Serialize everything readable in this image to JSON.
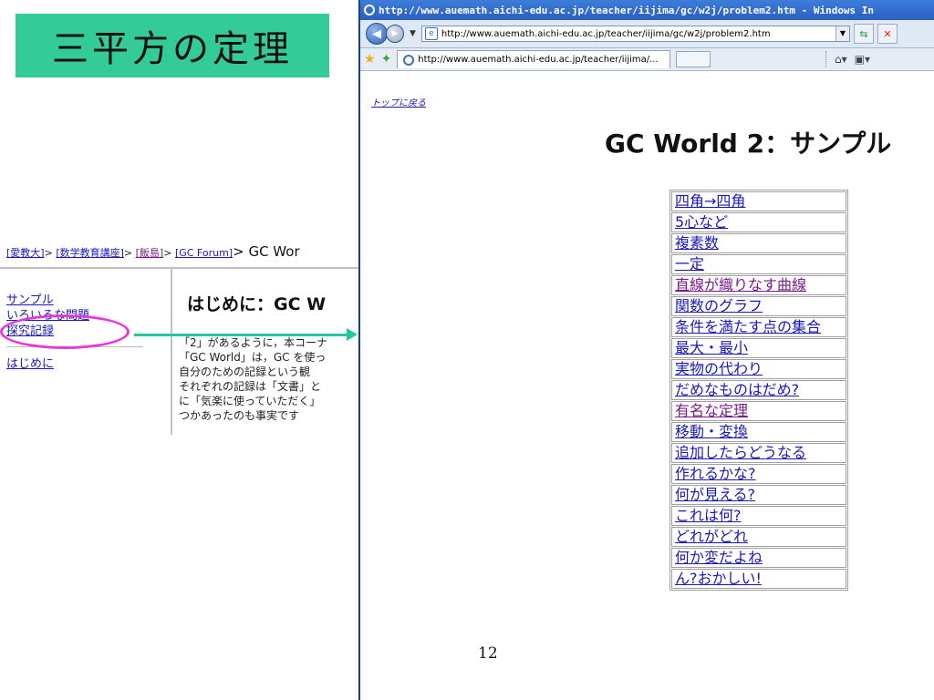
{
  "slide": {
    "title": "三平方の定理",
    "page_number": "12"
  },
  "left_page": {
    "breadcrumb": {
      "items": [
        "[愛教大]",
        "[数学教育講座]",
        "[飯島]",
        "[GC Forum]"
      ],
      "separator": ">",
      "tail": "> GC Wor"
    },
    "menu": {
      "items": [
        "サンプル",
        "いろいろな問題",
        "探究記録"
      ],
      "after_sep": "はじめに"
    },
    "heading": "はじめに：GC W",
    "body_lines": [
      "「2」があるように，本コーナ",
      "「GC World」は，GC を使っ",
      "自分のための記録という観",
      "それぞれの記録は「文書」と",
      "に「気楽に使っていただく」",
      "つかあったのも事実です"
    ]
  },
  "browser": {
    "title": "http://www.auemath.aichi-edu.ac.jp/teacher/iijima/gc/w2j/problem2.htm - Windows In",
    "url": "http://www.auemath.aichi-edu.ac.jp/teacher/iijima/gc/w2j/problem2.htm",
    "tab_label": "http://www.auemath.aichi-edu.ac.jp/teacher/iijima/...",
    "back_to_top": "トップに戻る",
    "heading": "GC World 2：サンプル",
    "links": [
      {
        "label": "四角→四角",
        "visited": false
      },
      {
        "label": "5心など",
        "visited": false
      },
      {
        "label": "複素数",
        "visited": false
      },
      {
        "label": "一定",
        "visited": false
      },
      {
        "label": "直線が織りなす曲線",
        "visited": true
      },
      {
        "label": "関数のグラフ",
        "visited": false
      },
      {
        "label": "条件を満たす点の集合",
        "visited": false
      },
      {
        "label": "最大・最小",
        "visited": false
      },
      {
        "label": "実物の代わり",
        "visited": false
      },
      {
        "label": "だめなものはだめ?",
        "visited": false
      },
      {
        "label": "有名な定理",
        "visited": true
      },
      {
        "label": "移動・変換",
        "visited": false
      },
      {
        "label": "追加したらどうなる",
        "visited": false
      },
      {
        "label": "作れるかな?",
        "visited": false
      },
      {
        "label": "何が見える?",
        "visited": false
      },
      {
        "label": "これは何?",
        "visited": false
      },
      {
        "label": "どれがどれ",
        "visited": false
      },
      {
        "label": "何か変だよね",
        "visited": false
      },
      {
        "label": "ん?おかしい!",
        "visited": false
      }
    ]
  },
  "colors": {
    "title_box": "#33cc99",
    "arrow": "#23c8a3",
    "highlight_oval": "#e23bd9",
    "link": "#1a1ab8",
    "visited_link": "#7a1a8a"
  }
}
